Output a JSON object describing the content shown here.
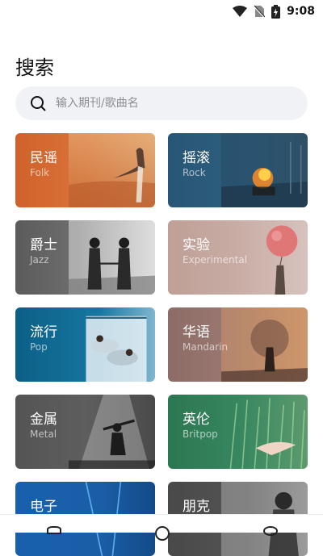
{
  "status": {
    "time": "9:08"
  },
  "page_title": "搜索",
  "search": {
    "placeholder": "输入期刊/歌曲名"
  },
  "genres": [
    {
      "cn": "民谣",
      "en": "Folk"
    },
    {
      "cn": "摇滚",
      "en": "Rock"
    },
    {
      "cn": "爵士",
      "en": "Jazz"
    },
    {
      "cn": "实验",
      "en": "Experimental"
    },
    {
      "cn": "流行",
      "en": "Pop"
    },
    {
      "cn": "华语",
      "en": "Mandarin"
    },
    {
      "cn": "金属",
      "en": "Metal"
    },
    {
      "cn": "英伦",
      "en": "Britpop"
    },
    {
      "cn": "电子",
      "en": ""
    },
    {
      "cn": "朋克",
      "en": ""
    }
  ],
  "colors": {
    "folk": "#d0682a",
    "rock": "#2b5a78",
    "jazz": "#5e5e5e",
    "experimental": "#c3a59c",
    "pop": "#0f5f86",
    "mandarin": "#8f6e6a",
    "metal": "#555555",
    "britpop": "#2e7a55",
    "electronic": "#1a5fa8",
    "punk": "#4a4a4a"
  }
}
